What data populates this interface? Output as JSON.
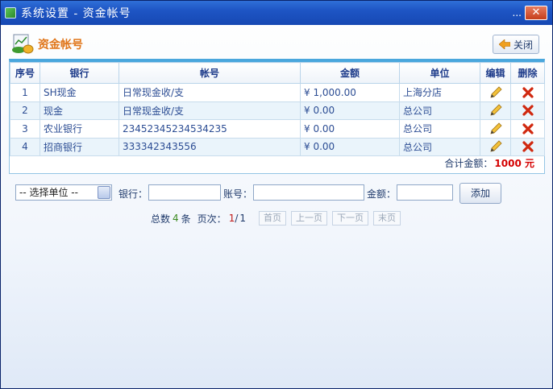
{
  "window": {
    "title": "系统设置 - 资金帐号",
    "dots": "...",
    "close_glyph": "✕"
  },
  "header": {
    "title": "资金帐号",
    "close_label": "关闭"
  },
  "table": {
    "columns": [
      "序号",
      "银行",
      "帐号",
      "金额",
      "单位",
      "编辑",
      "删除"
    ],
    "rows": [
      {
        "no": "1",
        "bank": "SH现金",
        "account": "日常现金收/支",
        "amount": "¥ 1,000.00",
        "unit": "上海分店"
      },
      {
        "no": "2",
        "bank": "现金",
        "account": "日常现金收/支",
        "amount": "¥ 0.00",
        "unit": "总公司"
      },
      {
        "no": "3",
        "bank": "农业银行",
        "account": "23452345234534235",
        "amount": "¥ 0.00",
        "unit": "总公司"
      },
      {
        "no": "4",
        "bank": "招商银行",
        "account": "333342343556",
        "amount": "¥ 0.00",
        "unit": "总公司"
      }
    ],
    "total_label": "合计金额：",
    "total_value": "1000 元"
  },
  "form": {
    "unit_select": "-- 选择单位 --",
    "bank_label": "银行：",
    "account_label": "账号：",
    "amount_label": "金额：",
    "add_label": "添加"
  },
  "pager": {
    "count_prefix": "总数",
    "count": "4",
    "count_suffix": "条",
    "page_label": "页次：",
    "page": "1",
    "page_sep": "/",
    "pages": "1",
    "first": "首页",
    "prev": "上一页",
    "next": "下一页",
    "last": "末页"
  },
  "icons": {
    "app": "app-icon",
    "header": "money-chart-icon",
    "close_button": "arrow-left-icon",
    "edit": "pencil-icon",
    "delete": "delete-x-icon"
  },
  "colors": {
    "title_bar": "#1e55c4",
    "accent_orange": "#e0761a",
    "total_red": "#d40000",
    "table_top_border": "#4aa7dd"
  }
}
